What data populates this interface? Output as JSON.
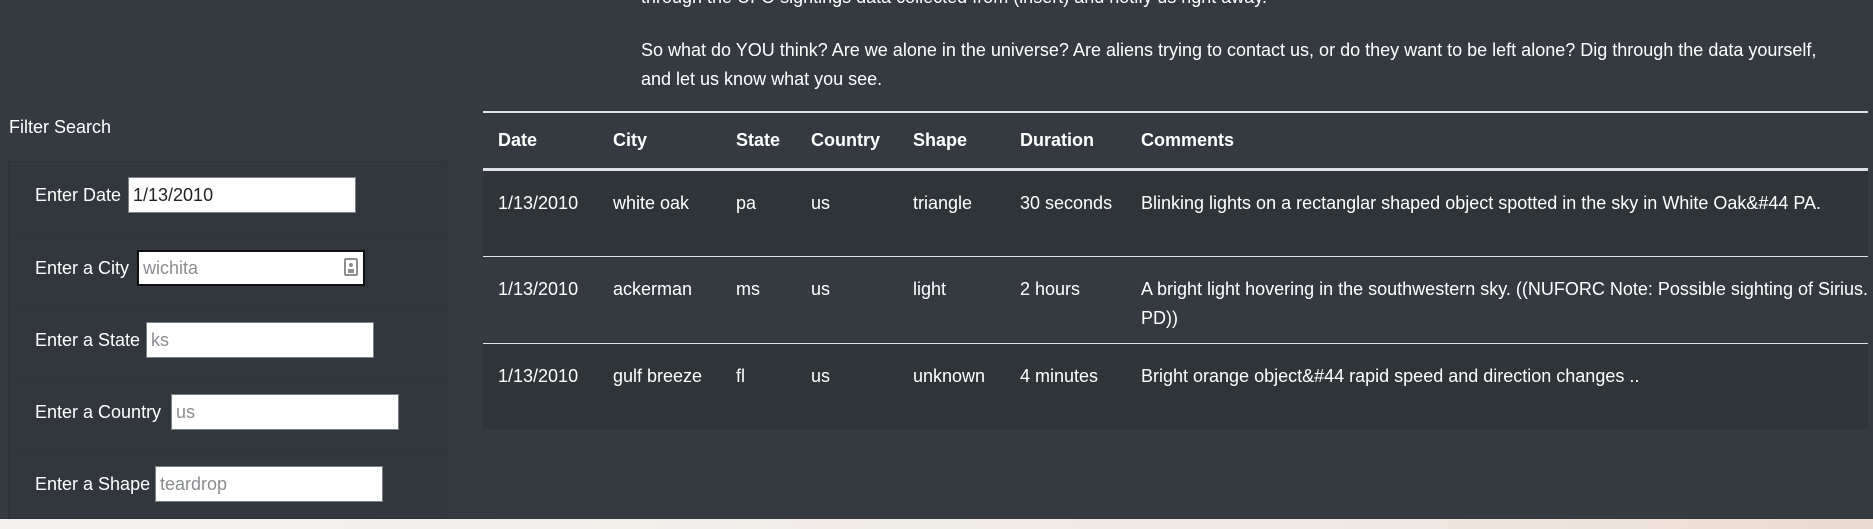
{
  "intro": {
    "partial_line": "through the UFO sightings data collected from (insert) and notify us right away.",
    "paragraph": "So what do YOU think? Are we alone in the universe? Are aliens trying to contact us, or do they want to be left alone? Dig through the data yourself, and let us know what you see."
  },
  "filters": {
    "title": "Filter Search",
    "date": {
      "label": "Enter Date",
      "value": "1/13/2010"
    },
    "city": {
      "label": "Enter a City",
      "placeholder": "wichita",
      "icon": "autofill-icon"
    },
    "state": {
      "label": "Enter a State",
      "placeholder": "ks"
    },
    "country": {
      "label": "Enter a Country",
      "placeholder": "us"
    },
    "shape": {
      "label": "Enter a Shape",
      "placeholder": "teardrop"
    }
  },
  "table": {
    "headers": {
      "date": "Date",
      "city": "City",
      "state": "State",
      "country": "Country",
      "shape": "Shape",
      "duration": "Duration",
      "comments": "Comments"
    },
    "rows": [
      {
        "date": "1/13/2010",
        "city": "white oak",
        "state": "pa",
        "country": "us",
        "shape": "triangle",
        "duration": "30 seconds",
        "comments": "Blinking lights on a rectanglar shaped object spotted in the sky in White Oak&#44 PA."
      },
      {
        "date": "1/13/2010",
        "city": "ackerman",
        "state": "ms",
        "country": "us",
        "shape": "light",
        "duration": "2 hours",
        "comments": "A bright light hovering in the southwestern sky. ((NUFORC Note: Possible sighting of Sirius. PD))"
      },
      {
        "date": "1/13/2010",
        "city": "gulf breeze",
        "state": "fl",
        "country": "us",
        "shape": "unknown",
        "duration": "4 minutes",
        "comments": "Bright orange object&#44 rapid speed and direction changes .."
      }
    ]
  },
  "colors": {
    "page_background": "#343a40",
    "table_rule": "#dee2e6",
    "input_background": "#ffffff"
  }
}
